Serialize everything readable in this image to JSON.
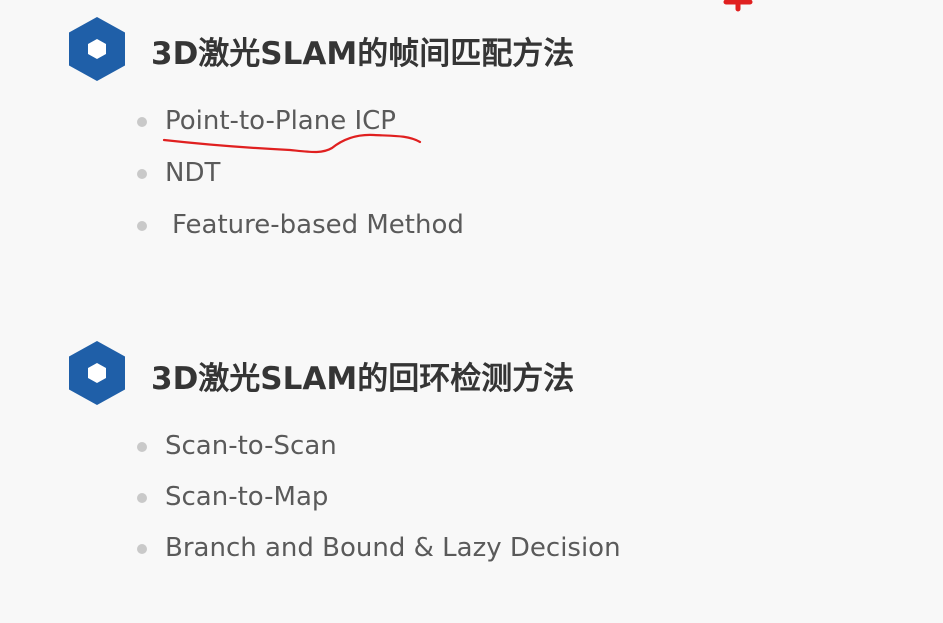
{
  "sections": [
    {
      "heading": "3D激光SLAM的帧间匹配方法",
      "items": [
        "Point-to-Plane ICP",
        "NDT",
        "Feature-based Method"
      ]
    },
    {
      "heading": "3D激光SLAM的回环检测方法",
      "items": [
        "Scan-to-Scan",
        "Scan-to-Map",
        "Branch and Bound & Lazy Decision"
      ]
    }
  ],
  "colors": {
    "background": "#f8f8f8",
    "accent_blue": "#1f5fa8",
    "heading_text": "#353535",
    "bullet_text": "#5a5a5a",
    "bullet_dot": "#c9c9c9",
    "annotation_red": "#e02020"
  },
  "icons": {
    "section_marker": "hexagon-icon"
  }
}
